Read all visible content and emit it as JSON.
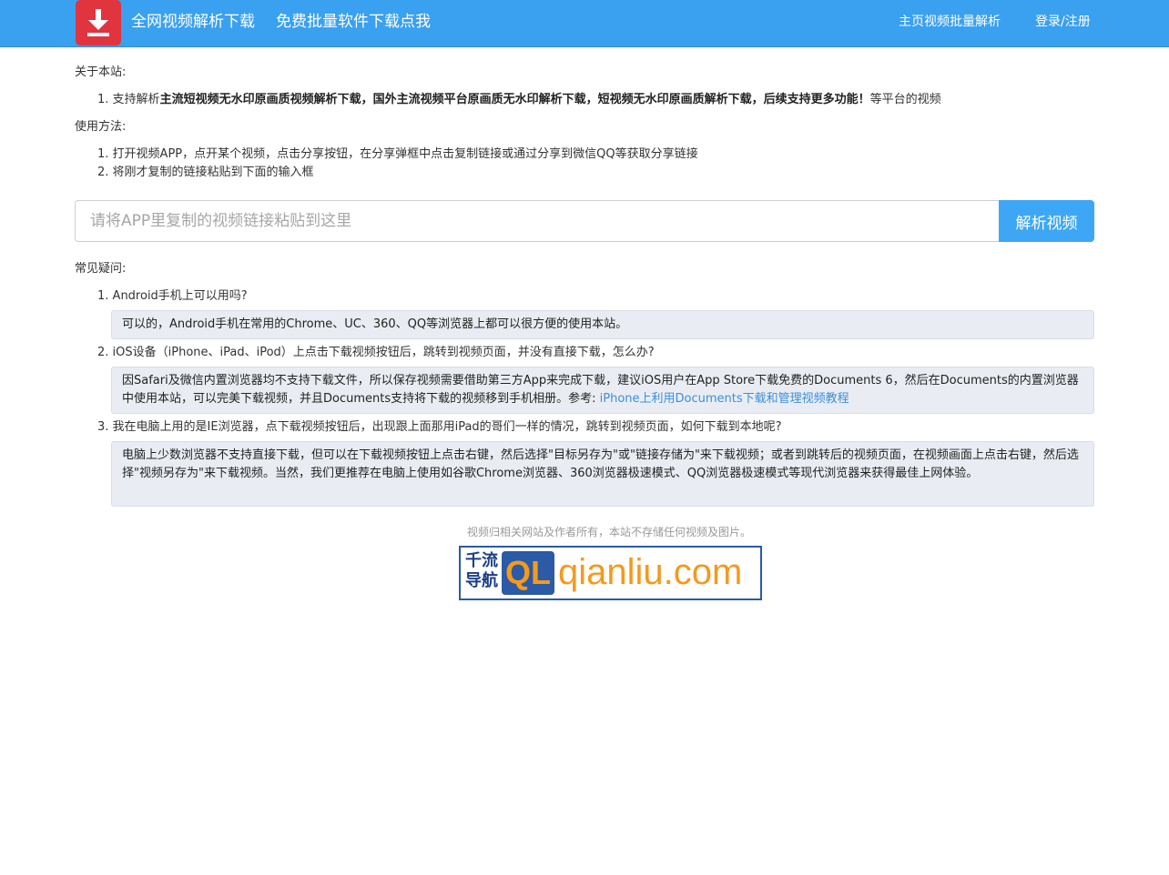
{
  "header": {
    "title": "全网视频解析下载",
    "batch_link": "免费批量软件下载点我",
    "nav": [
      "主页视频批量解析",
      "登录/注册"
    ]
  },
  "about": {
    "label": "关于本站:",
    "item_prefix": "支持解析",
    "item_bold": "主流短视频无水印原画质视频解析下载，国外主流视频平台原画质无水印解析下载，短视频无水印原画质解析下载，后续支持更多功能！",
    "item_suffix": "等平台的视频"
  },
  "usage": {
    "label": "使用方法:",
    "steps": [
      "打开视频APP，点开某个视频，点击分享按钮，在分享弹框中点击复制链接或通过分享到微信QQ等获取分享链接",
      "将刚才复制的链接粘贴到下面的输入框"
    ]
  },
  "search": {
    "placeholder": "请将APP里复制的视频链接粘贴到这里",
    "button": "解析视频"
  },
  "faq": {
    "label": "常见疑问:",
    "items": [
      {
        "q": "Android手机上可以用吗?",
        "a": "可以的，Android手机在常用的Chrome、UC、360、QQ等浏览器上都可以很方便的使用本站。"
      },
      {
        "q": "iOS设备（iPhone、iPad、iPod）上点击下载视频按钮后，跳转到视频页面，并没有直接下载，怎么办?",
        "a": "因Safari及微信内置浏览器均不支持下载文件，所以保存视频需要借助第三方App来完成下载，建议iOS用户在App Store下载免费的Documents 6，然后在Documents的内置浏览器中使用本站，可以完美下载视频，并且Documents支持将下载的视频移到手机相册。参考: ",
        "link": "iPhone上利用Documents下载和管理视频教程"
      },
      {
        "q": "我在电脑上用的是IE浏览器，点下载视频按钮后，出现跟上面那用iPad的哥们一样的情况，跳转到视频页面，如何下载到本地呢?",
        "a": "电脑上少数浏览器不支持直接下载，但可以在下载视频按钮上点击右键，然后选择\"目标另存为\"或\"链接存储为\"来下载视频；或者到跳转后的视频页面，在视频画面上点击右键，然后选择\"视频另存为\"来下载视频。当然，我们更推荐在电脑上使用如谷歌Chrome浏览器、360浏览器极速模式、QQ浏览器极速模式等现代浏览器来获得最佳上网体验。"
      }
    ]
  },
  "footer": {
    "note": "视频归相关网站及作者所有，本站不存储任何视频及图片。",
    "partner_cn_1": "千流",
    "partner_cn_2": "导航",
    "partner_ql": "QL",
    "partner_domain": "qianliu.com"
  },
  "colors": {
    "navbar": "#3aa0f0",
    "logo": "#e0343f",
    "button": "#3ea7f5",
    "answer_bg": "#e9edf3",
    "link": "#3a8ee0"
  },
  "icons": {
    "logo": "download-icon"
  }
}
